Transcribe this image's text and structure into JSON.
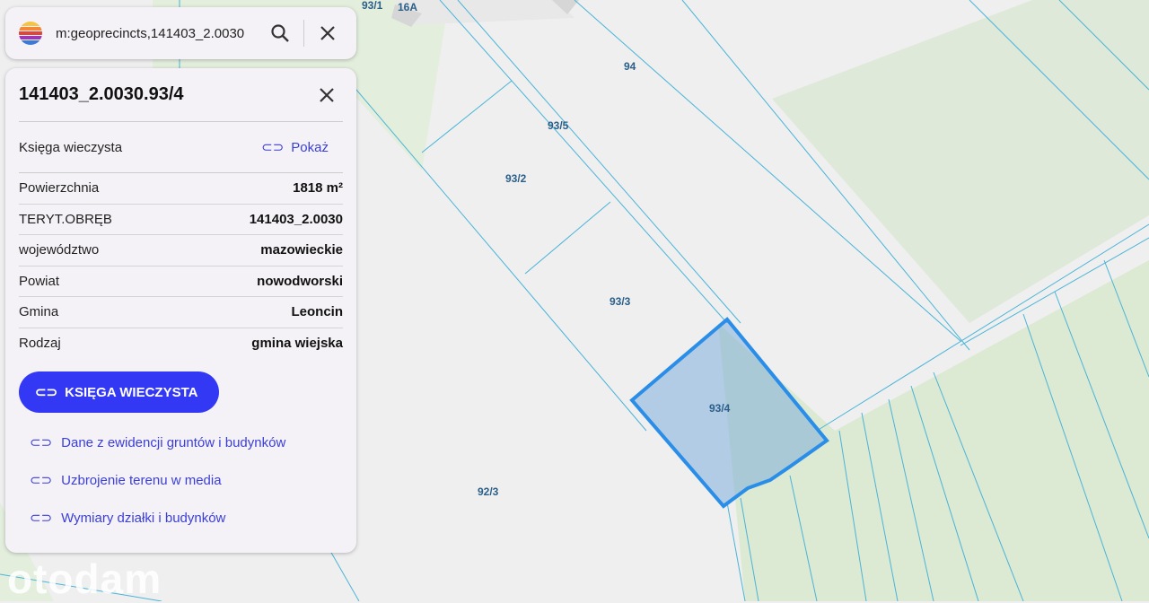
{
  "search": {
    "query": "m:geoprecincts,141403_2.0030"
  },
  "panel": {
    "title": "141403_2.0030.93/4",
    "kw_label": "Księga wieczysta",
    "kw_link": "Pokaż",
    "rows": [
      {
        "label": "Powierzchnia",
        "value": "1818 m²"
      },
      {
        "label": "TERYT.OBRĘB",
        "value": "141403_2.0030"
      },
      {
        "label": "województwo",
        "value": "mazowieckie"
      },
      {
        "label": "Powiat",
        "value": "nowodworski"
      },
      {
        "label": "Gmina",
        "value": "Leoncin"
      },
      {
        "label": "Rodzaj",
        "value": "gmina wiejska"
      }
    ],
    "button": "KSIĘGA WIECZYSTA",
    "links": [
      "Dane z ewidencji gruntów i budynków",
      "Uzbrojenie terenu w media",
      "Wymiary działki i budynków"
    ]
  },
  "map": {
    "labels": [
      "93/1",
      "16A",
      "94",
      "93/5",
      "93/2",
      "93/3",
      "93/4",
      "92/3"
    ],
    "highlight": "#2a8ee8"
  },
  "watermark": "otodam"
}
